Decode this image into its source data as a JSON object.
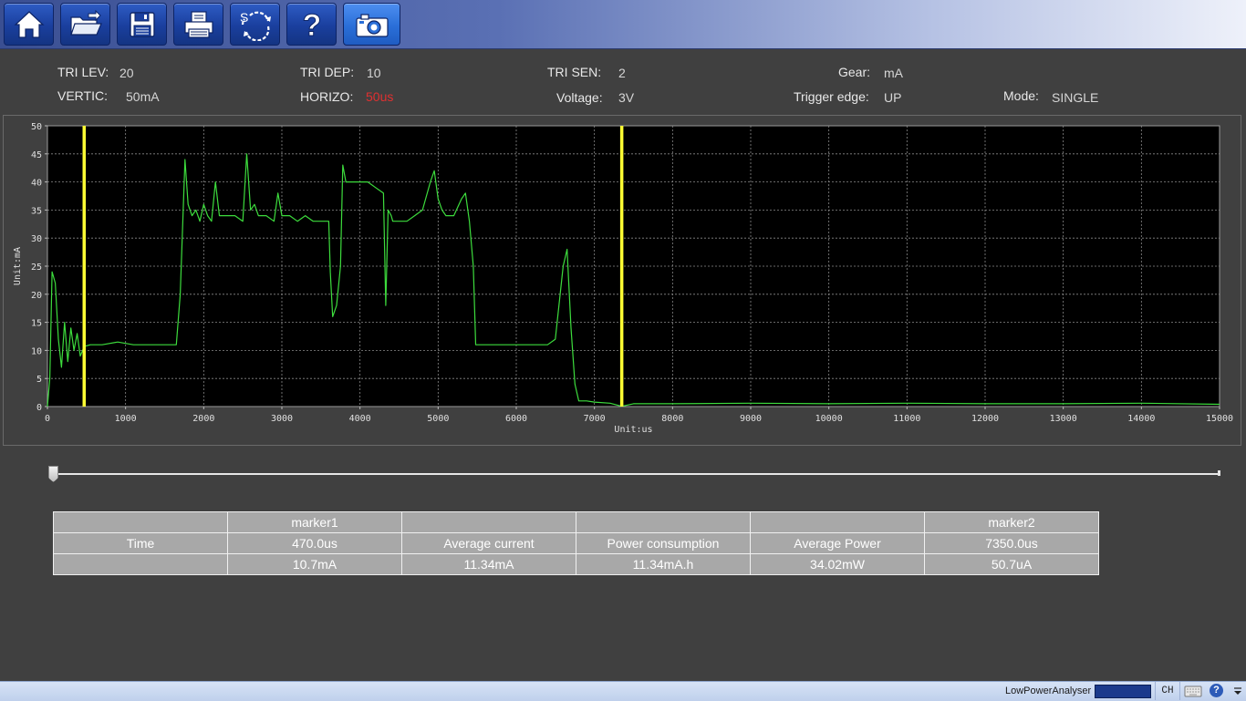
{
  "toolbar": {
    "buttons": [
      {
        "icon": "home-icon"
      },
      {
        "icon": "open-folder-icon"
      },
      {
        "icon": "save-icon"
      },
      {
        "icon": "print-icon"
      },
      {
        "icon": "sync-settings-icon",
        "glyph": "S"
      },
      {
        "icon": "help-icon",
        "glyph": "?"
      },
      {
        "icon": "camera-icon",
        "active": true
      }
    ]
  },
  "params": {
    "tri_lev": {
      "label": "TRI LEV:",
      "value": "20"
    },
    "tri_dep": {
      "label": "TRI DEP:",
      "value": "10"
    },
    "tri_sen": {
      "label": "TRI SEN:",
      "value": "2"
    },
    "gear": {
      "label": "Gear:",
      "value": "mA"
    },
    "vertic": {
      "label": "VERTIC:",
      "value": "50mA"
    },
    "horizo": {
      "label": "HORIZO:",
      "value": "50us",
      "color": "#e03030"
    },
    "voltage": {
      "label": "Voltage:",
      "value": "3V"
    },
    "trigger_edge": {
      "label": "Trigger edge:",
      "value": "UP"
    },
    "mode": {
      "label": "Mode:",
      "value": "SINGLE"
    }
  },
  "chart_data": {
    "type": "line",
    "xlabel": "Unit:us",
    "ylabel": "Unit:mA",
    "xlim": [
      0,
      15000
    ],
    "ylim": [
      0,
      50
    ],
    "x_ticks": [
      0,
      1000,
      2000,
      3000,
      4000,
      5000,
      6000,
      7000,
      8000,
      9000,
      10000,
      11000,
      12000,
      13000,
      14000,
      15000
    ],
    "y_ticks": [
      0,
      5,
      10,
      15,
      20,
      25,
      30,
      35,
      40,
      45,
      50
    ],
    "grid": true,
    "background": "#000000",
    "line_color": "#3ddc3d",
    "marker_color": "#ffff33",
    "markers": [
      {
        "name": "marker1",
        "x": 470
      },
      {
        "name": "marker2",
        "x": 7350
      }
    ],
    "series": [
      {
        "x": [
          0,
          30,
          60,
          100,
          140,
          180,
          220,
          260,
          300,
          340,
          380,
          420,
          470,
          550,
          700,
          900,
          1100,
          1300,
          1500,
          1650,
          1700,
          1760,
          1800,
          1850,
          1900,
          1950,
          2000,
          2050,
          2100,
          2150,
          2200,
          2300,
          2400,
          2500,
          2550,
          2600,
          2650,
          2700,
          2800,
          2900,
          2950,
          3000,
          3100,
          3200,
          3300,
          3400,
          3500,
          3600,
          3620,
          3650,
          3700,
          3750,
          3780,
          3820,
          3900,
          4000,
          4100,
          4200,
          4300,
          4330,
          4360,
          4400,
          4420,
          4450,
          4500,
          4600,
          4700,
          4800,
          4900,
          4950,
          5000,
          5050,
          5100,
          5200,
          5300,
          5350,
          5400,
          5450,
          5480,
          5520,
          5600,
          5800,
          6000,
          6200,
          6400,
          6500,
          6600,
          6650,
          6700,
          6750,
          6800,
          6900,
          7000,
          7200,
          7350,
          7500,
          8000,
          9000,
          10000,
          11000,
          12000,
          13000,
          14000,
          15000
        ],
        "values": [
          0,
          5,
          24,
          22,
          12,
          7,
          15,
          8,
          14,
          10,
          13,
          9,
          10.7,
          11,
          11,
          11.5,
          11,
          11,
          11,
          11,
          20,
          44,
          36,
          34,
          35,
          33,
          36,
          34,
          33,
          40,
          34,
          34,
          34,
          33,
          45,
          35,
          36,
          34,
          34,
          33,
          38,
          34,
          34,
          33,
          34,
          33,
          33,
          33,
          24,
          16,
          18,
          25,
          43,
          40,
          40,
          40,
          40,
          39,
          38,
          18,
          35,
          34,
          33,
          33,
          33,
          33,
          34,
          35,
          40,
          42,
          37,
          35,
          34,
          34,
          37,
          38,
          33,
          25,
          11,
          11,
          11,
          11,
          11,
          11,
          11,
          12,
          25,
          28,
          14,
          4,
          1,
          1,
          0.8,
          0.6,
          0.05,
          0.5,
          0.5,
          0.6,
          0.5,
          0.6,
          0.5,
          0.5,
          0.6,
          0.4
        ]
      }
    ]
  },
  "table": {
    "rows": [
      [
        "",
        "marker1",
        "",
        "",
        "",
        "marker2"
      ],
      [
        "Time",
        "470.0us",
        "Average current",
        "Power consumption",
        "Average Power",
        "7350.0us"
      ],
      [
        "",
        "10.7mA",
        "11.34mA",
        "11.34mA.h",
        "34.02mW",
        "50.7uA"
      ]
    ]
  },
  "taskbar": {
    "title": "LowPowerAnalyser",
    "lang": "CH",
    "help": "?"
  }
}
